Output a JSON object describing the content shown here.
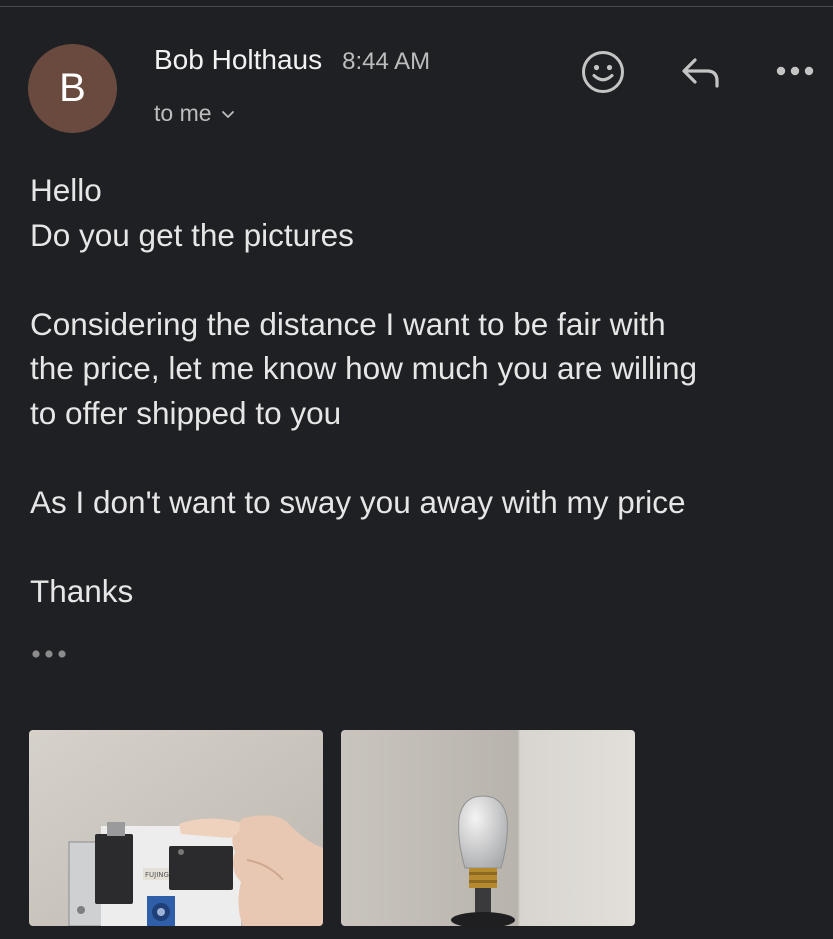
{
  "message": {
    "sender": {
      "initial": "B",
      "name": "Bob Holthaus",
      "avatar_color": "#6a4a3f"
    },
    "time": "8:44 AM",
    "recipient_label": "to me",
    "actions": [
      {
        "icon": "smiley-icon"
      },
      {
        "icon": "reply-icon"
      },
      {
        "icon": "more-horizontal-icon"
      }
    ],
    "body": {
      "greeting": "Hello",
      "line1": "Do you get the pictures",
      "paragraph2_line1": "Considering the distance I want to be fair with",
      "paragraph2_line2": "the price, let me know how much you are willing",
      "paragraph2_line3": "to offer shipped to you",
      "paragraph3": "As I don't want to sway you away with my price",
      "closing": "Thanks"
    },
    "trimmed_content_icon": "ellipsis-icon",
    "attachments": [
      {
        "kind": "image",
        "label_on_device": "FUJING",
        "subject": "hand holding switch mechanism"
      },
      {
        "kind": "image",
        "subject": "clear bulb-shaped knob on stand"
      }
    ]
  },
  "colors": {
    "background": "#1f2023",
    "text_primary": "#e6e6e6",
    "text_secondary": "#bdbdbd",
    "icon": "#c4c4c4"
  }
}
